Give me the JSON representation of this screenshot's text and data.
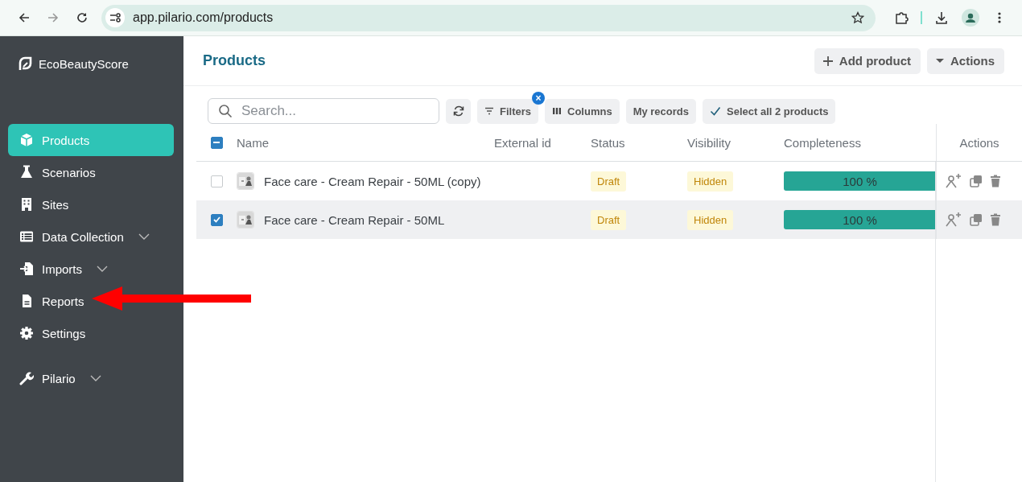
{
  "browser": {
    "url": "app.pilario.com/products"
  },
  "sidebar": {
    "brand": "EcoBeautyScore",
    "items": [
      {
        "label": "Products",
        "kind": "link",
        "selected": true
      },
      {
        "label": "Scenarios",
        "kind": "link",
        "selected": false
      },
      {
        "label": "Sites",
        "kind": "link",
        "selected": false
      },
      {
        "label": "Data Collection",
        "kind": "group",
        "expanded": false,
        "selected": false
      },
      {
        "label": "Imports",
        "kind": "group",
        "expanded": false,
        "selected": false
      },
      {
        "label": "Reports",
        "kind": "link",
        "selected": false
      },
      {
        "label": "Settings",
        "kind": "link",
        "selected": false
      },
      {
        "label": "Pilario",
        "kind": "group",
        "expanded": false,
        "selected": false
      }
    ]
  },
  "page": {
    "title": "Products",
    "buttons": [
      {
        "label": "Add product",
        "kind": "add"
      },
      {
        "label": "Actions",
        "kind": "menu"
      }
    ]
  },
  "toolbar": {
    "search": {
      "placeholder": "Search..."
    },
    "buttons": [
      {
        "kind": "refresh"
      },
      {
        "kind": "filters",
        "label": "Filters",
        "badge": "×"
      },
      {
        "kind": "columns",
        "label": "Columns"
      },
      {
        "kind": "plain",
        "label": "My records"
      },
      {
        "kind": "check",
        "label": "Select all 2 products"
      }
    ]
  },
  "table": {
    "select_all": {
      "checked": true,
      "partial": true
    },
    "columns": [
      "Name",
      "External id",
      "Status",
      "Visibility",
      "Completeness",
      "Actions"
    ],
    "rows": [
      {
        "selected": false,
        "name": "Face care - Cream Repair - 50ML (copy)",
        "status": "Draft",
        "visibility": "Hidden",
        "level": 1.0,
        "reading": "100 %"
      },
      {
        "selected": true,
        "name": "Face care - Cream Repair - 50ML",
        "status": "Draft",
        "visibility": "Hidden",
        "level": 1.0,
        "reading": "100 %"
      }
    ]
  }
}
